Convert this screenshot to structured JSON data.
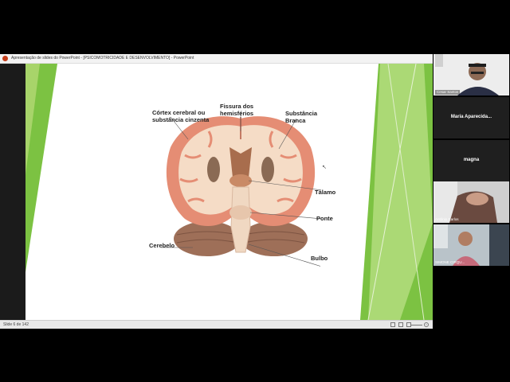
{
  "window": {
    "title": "Apresentação de slides do PowerPoint - [PSICOMOTRICIDADE E DESENVOLVIMENTO] - PowerPoint"
  },
  "status": {
    "slide_counter": "Slide 6 de 142"
  },
  "slide": {
    "labels": {
      "cortex": [
        "Córtex cerebral ou",
        "substância cinzenta"
      ],
      "fissura": [
        "Fissura dos",
        "hemisférios"
      ],
      "substancia": [
        "Substância",
        "Branca"
      ],
      "talamo": "Tálamo",
      "ponte": "Ponte",
      "cerebelo": "Cerebelo",
      "bulbo": "Bulbo"
    },
    "colors": {
      "accent_green": "#7cc242",
      "light_green": "#c5e39a",
      "cortex": "#e58d74",
      "white_matter": "#f5dcc6",
      "cerebellum": "#9e6f58"
    }
  },
  "participants": [
    {
      "name": "Cesar Santos",
      "type": "video"
    },
    {
      "name": "Maria Aparecida...",
      "type": "name-only"
    },
    {
      "name": "magna",
      "type": "name-only"
    },
    {
      "name": "Antônio Carlos",
      "type": "video"
    },
    {
      "name": "SIMONE CIRQU...",
      "type": "video"
    }
  ]
}
